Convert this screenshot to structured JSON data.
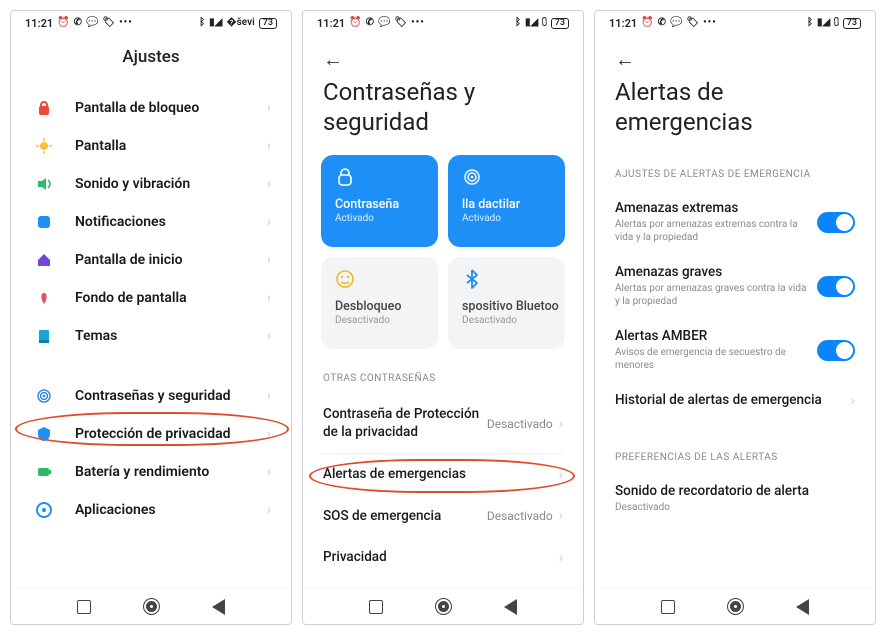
{
  "status": {
    "time": "11:21",
    "left_icons": [
      "alarm-icon",
      "whatsapp-icon",
      "chat-icon",
      "tag-icon",
      "more-icon"
    ],
    "right_icons": [
      "bluetooth-icon",
      "signal-icon",
      "wifi-icon"
    ],
    "battery": "73"
  },
  "s1": {
    "title": "Ajustes",
    "rows": [
      {
        "icon": "lock-icon",
        "color": "#e94a3a",
        "label": "Pantalla de bloqueo"
      },
      {
        "icon": "sun-icon",
        "color": "#f6c13d",
        "label": "Pantalla"
      },
      {
        "icon": "speaker-icon",
        "color": "#2bbb67",
        "label": "Sonido y vibración"
      },
      {
        "icon": "notifications-icon",
        "color": "#1e8ff6",
        "label": "Notificaciones"
      },
      {
        "icon": "home-icon",
        "color": "#7346d6",
        "label": "Pantalla de inicio"
      },
      {
        "icon": "wallpaper-icon",
        "color": "#e7505c",
        "label": "Fondo de pantalla"
      },
      {
        "icon": "themes-icon",
        "color": "#1aa5d0",
        "label": "Temas"
      }
    ],
    "rows2": [
      {
        "icon": "fingerprint-icon",
        "color": "#1e78e8",
        "label": "Contraseñas y seguridad"
      },
      {
        "icon": "shield-icon",
        "color": "#1e8ff6",
        "label": "Protección de privacidad"
      },
      {
        "icon": "battery-icon",
        "color": "#2bbb67",
        "label": "Batería y rendimiento"
      },
      {
        "icon": "apps-icon",
        "color": "#1e8ff6",
        "label": "Aplicaciones"
      }
    ]
  },
  "s2": {
    "title_l1": "Contraseñas y",
    "title_l2": "seguridad",
    "cards": [
      {
        "style": "blue",
        "label": "Contraseña",
        "state": "Activado"
      },
      {
        "style": "blue",
        "label": "lla dactilar",
        "state": "Activado"
      },
      {
        "style": "grey",
        "label": "Desbloqueo",
        "state": "Desactivado"
      },
      {
        "style": "grey",
        "label": "spositivo Bluetoo",
        "state": "Desactivado"
      }
    ],
    "section1": "OTRAS CONTRASEÑAS",
    "rows1": [
      {
        "label": "Contraseña de Protección de la privacidad",
        "state": "Desactivado"
      }
    ],
    "rows2": [
      {
        "label": "Alertas de emergencias",
        "state": ""
      },
      {
        "label": "SOS de emergencia",
        "state": "Desactivado"
      },
      {
        "label": "Privacidad",
        "state": ""
      }
    ]
  },
  "s3": {
    "title_l1": "Alertas de",
    "title_l2": "emergencias",
    "section1": "AJUSTES DE ALERTAS DE EMERGENCIA",
    "toggles": [
      {
        "title": "Amenazas extremas",
        "desc": "Alertas por amenazas extremas contra la vida y la propiedad",
        "on": true
      },
      {
        "title": "Amenazas graves",
        "desc": "Alertas por amenazas graves contra la vida y la propiedad",
        "on": true
      },
      {
        "title": "Alertas AMBER",
        "desc": "Avisos de emergencia de secuestro de menores",
        "on": true
      }
    ],
    "history": "Historial de alertas de emergencia",
    "section2": "PREFERENCIAS DE LAS ALERTAS",
    "rows2": [
      {
        "title": "Sonido de recordatorio de alerta",
        "desc": "Desactivado"
      }
    ]
  }
}
